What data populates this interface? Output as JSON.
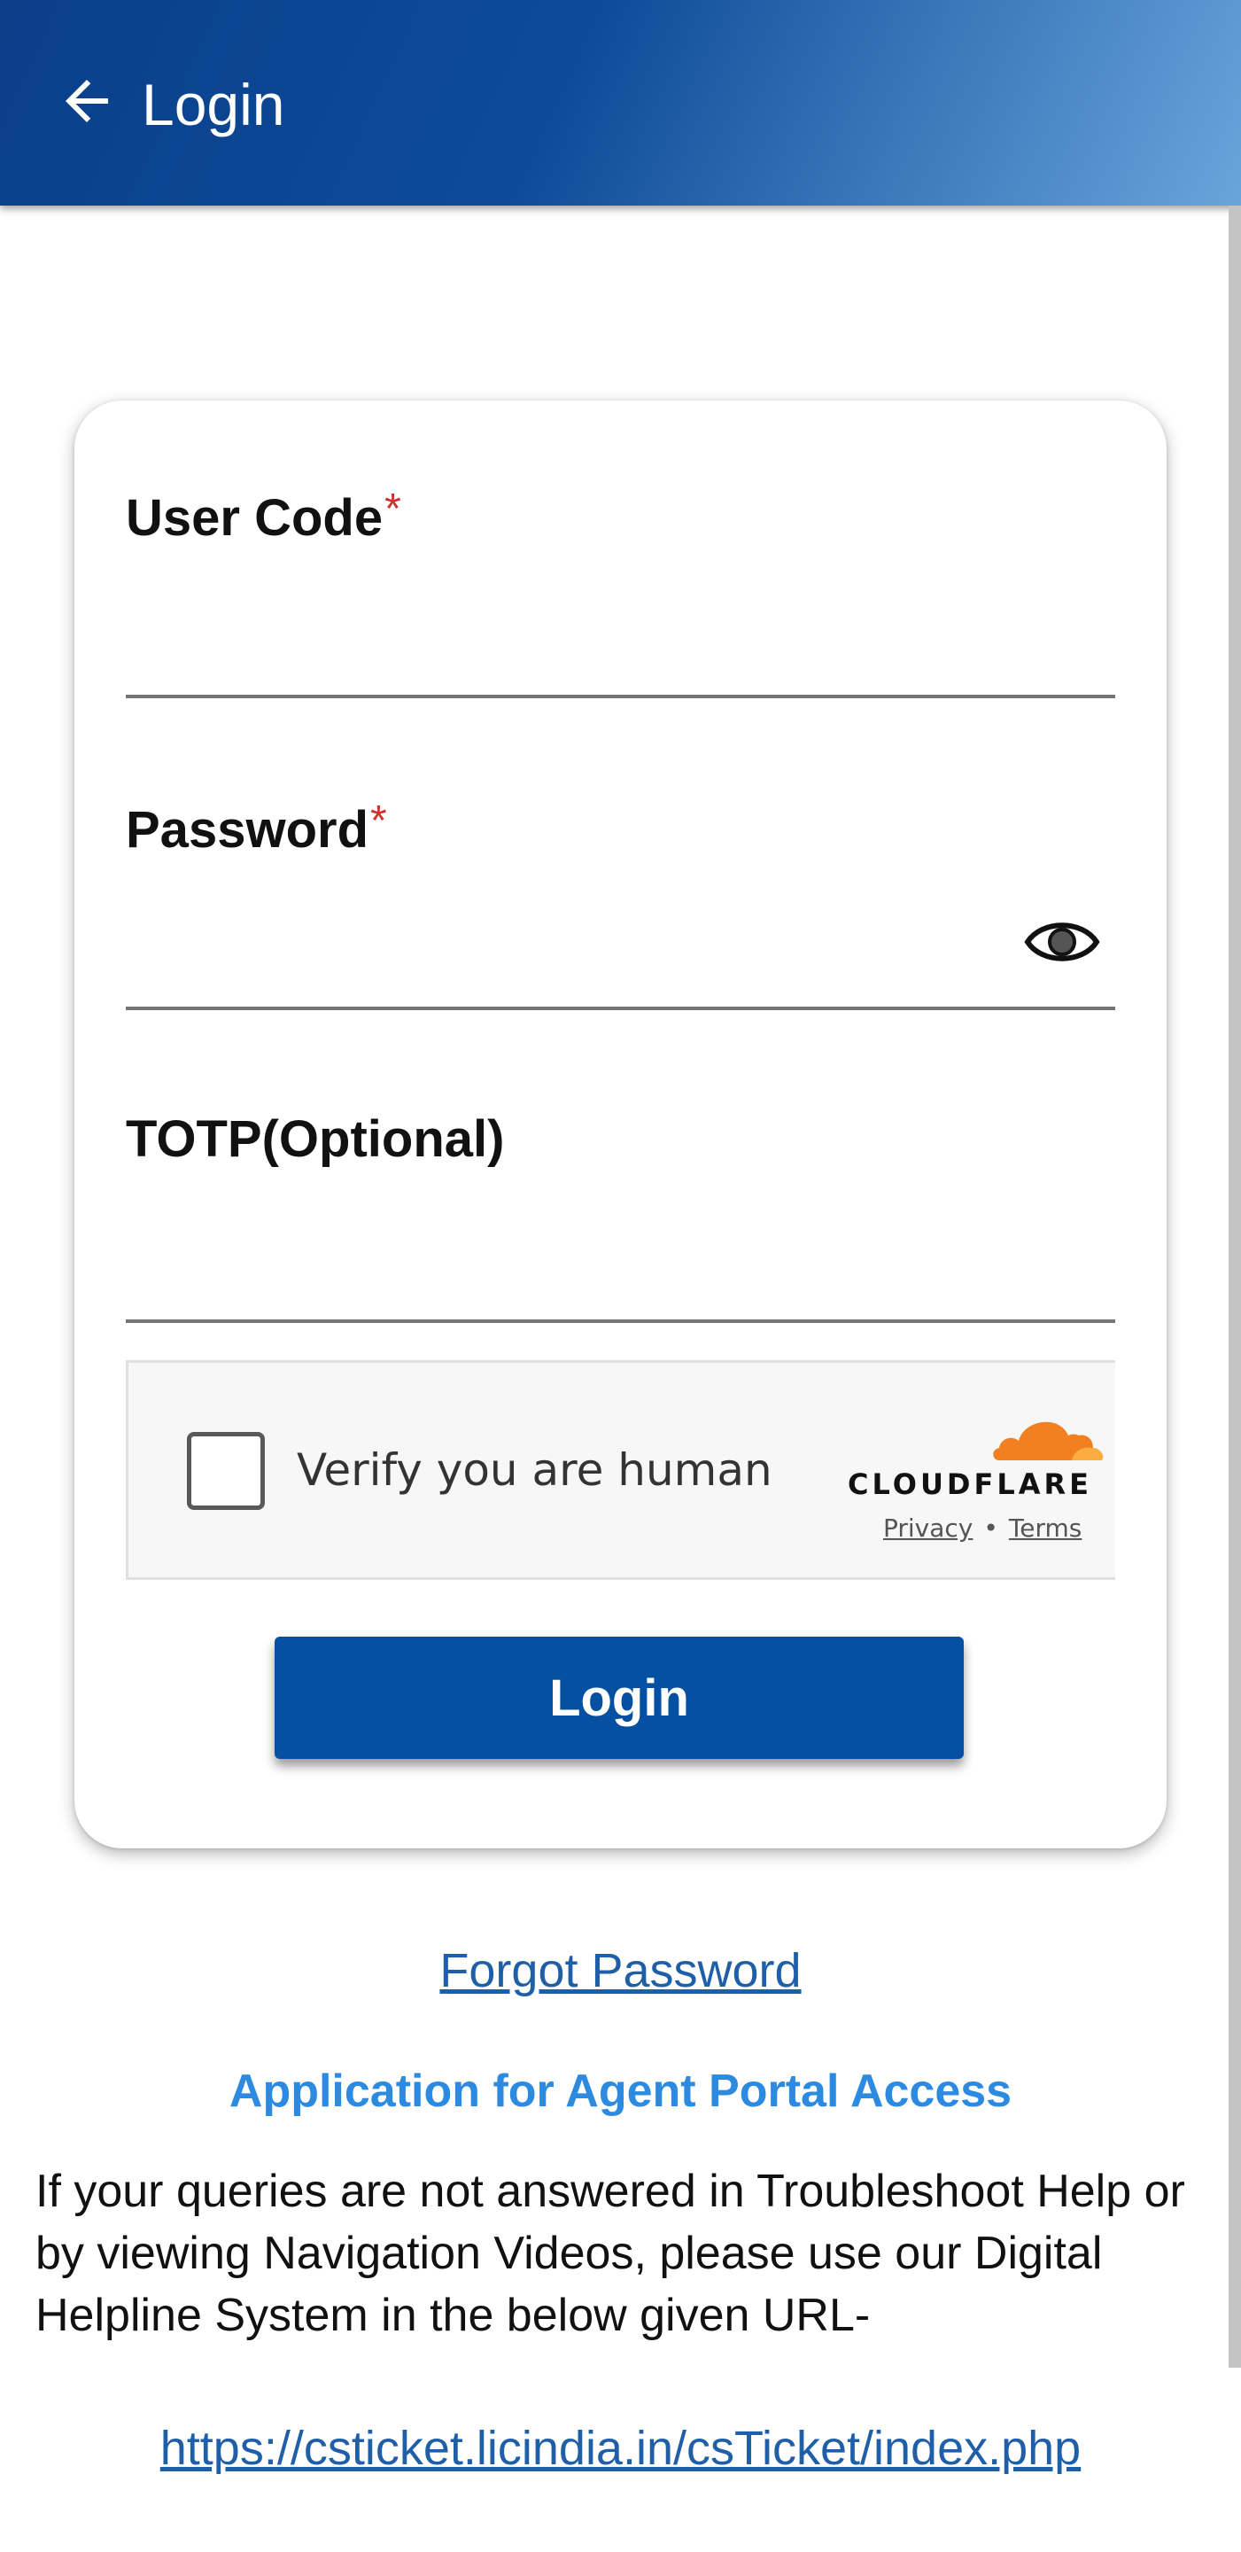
{
  "appbar": {
    "title": "Login",
    "back_icon": "arrow-left-icon"
  },
  "form": {
    "user_code": {
      "label": "User Code",
      "required_mark": "*",
      "value": "",
      "placeholder": ""
    },
    "password": {
      "label": "Password",
      "required_mark": "*",
      "value": "",
      "placeholder": "",
      "toggle_icon": "eye-icon"
    },
    "totp": {
      "label": "TOTP(Optional)",
      "value": "",
      "placeholder": ""
    },
    "captcha": {
      "text": "Verify you are human",
      "brand": "CLOUDFLARE",
      "privacy_link": "Privacy",
      "separator": "•",
      "terms_link": "Terms",
      "logo_icon": "cloudflare-cloud-icon"
    },
    "login_button": "Login"
  },
  "links": {
    "forgot_password": "Forgot Password",
    "agent_portal": "Application for Agent Portal Access"
  },
  "help": {
    "text": "If your queries are not answered in Troubleshoot Help or by viewing Navigation Videos, please use our Digital Helpline System in the below given URL-",
    "url": "https://csticket.licindia.in/csTicket/index.php"
  },
  "colors": {
    "appbar_start": "#0a3f8a",
    "appbar_end": "#6aa4dc",
    "button": "#0550a0",
    "link": "#1f5fa8",
    "accent_link": "#2c8ae0",
    "required": "#d32f2f",
    "cloudflare_orange": "#f38020"
  }
}
